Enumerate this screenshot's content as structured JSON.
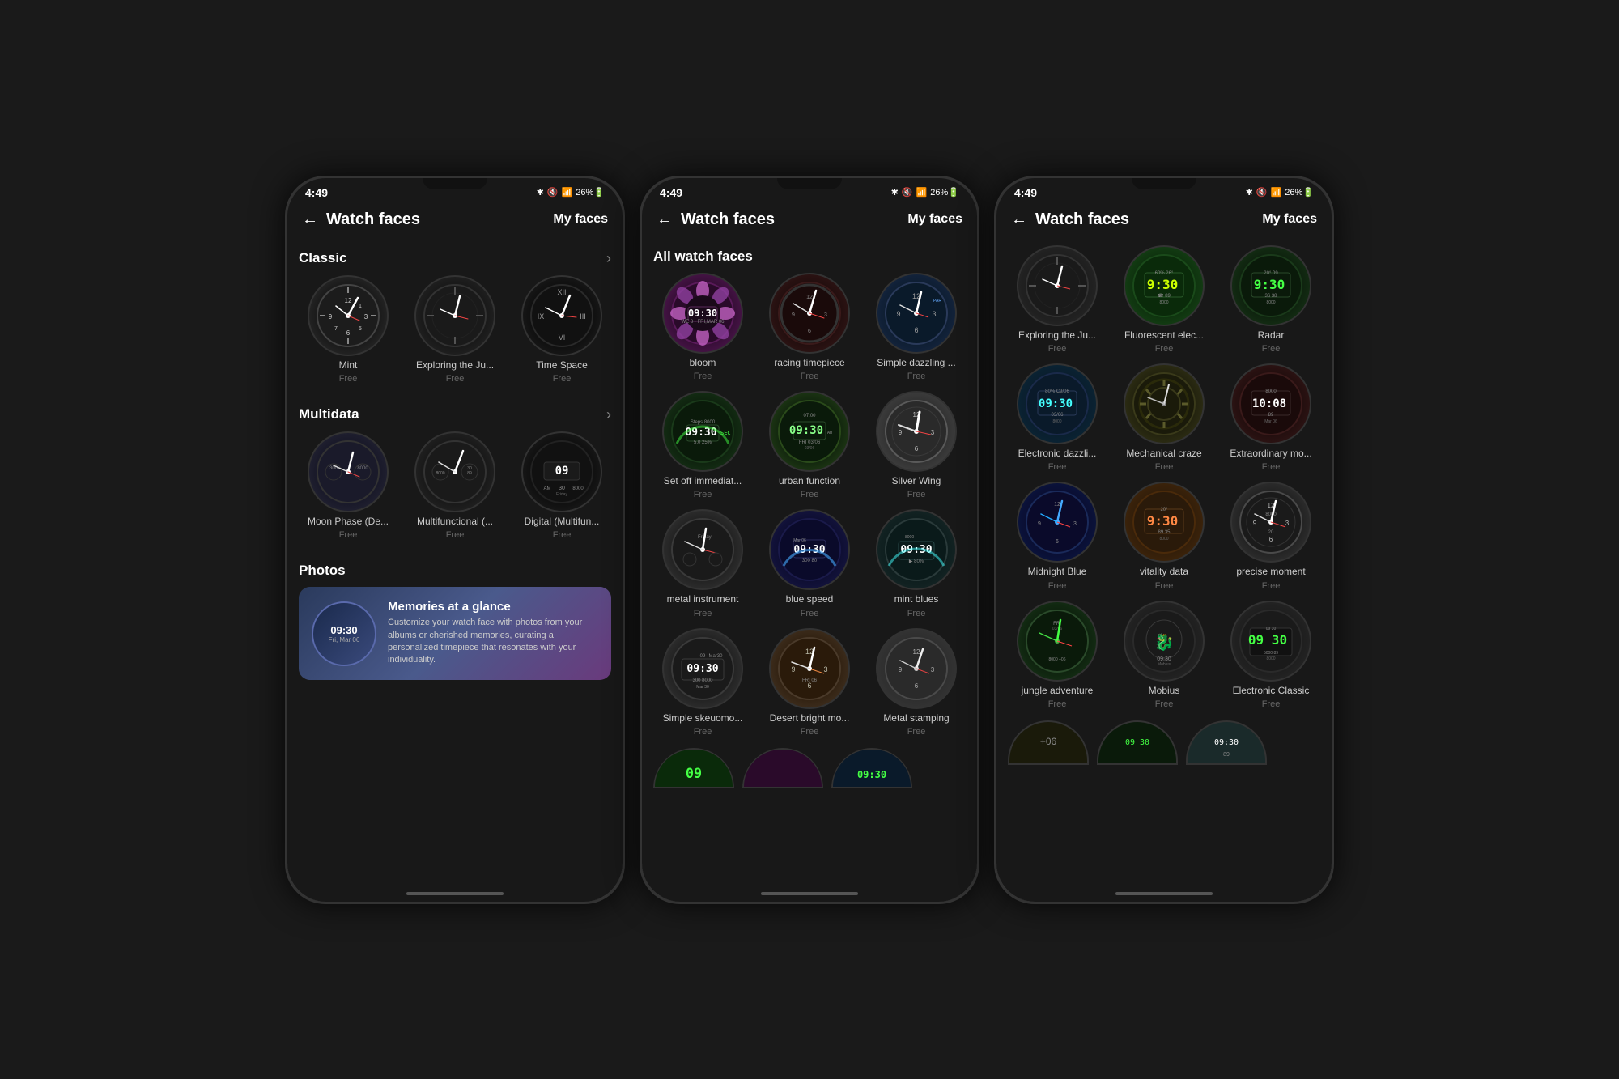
{
  "phones": [
    {
      "id": "phone1",
      "statusBar": {
        "time": "4:49",
        "icons": "✱ 🔇 ☁ ▲ 26%🔋"
      },
      "header": {
        "back": "←",
        "title": "Watch faces",
        "myFaces": "My faces"
      },
      "sections": [
        {
          "id": "classic",
          "title": "Classic",
          "hasArrow": true,
          "items": [
            {
              "label": "Mint",
              "sublabel": "Free",
              "wfClass": "wf-classic-mint",
              "type": "analog-simple"
            },
            {
              "label": "Exploring the Ju...",
              "sublabel": "Free",
              "wfClass": "wf-classic-exploring",
              "type": "analog-dark"
            },
            {
              "label": "Time Space",
              "sublabel": "Free",
              "wfClass": "wf-classic-timespace",
              "type": "analog-minimal"
            }
          ]
        },
        {
          "id": "multidata",
          "title": "Multidata",
          "hasArrow": true,
          "items": [
            {
              "label": "Moon Phase (De...",
              "sublabel": "Free",
              "wfClass": "wf-moon",
              "type": "analog-moon"
            },
            {
              "label": "Multifunctional (...",
              "sublabel": "Free",
              "wfClass": "wf-multifunc",
              "type": "analog-multi"
            },
            {
              "label": "Digital (Multifun...",
              "sublabel": "Free",
              "wfClass": "wf-digital",
              "type": "digital-multi"
            }
          ]
        }
      ],
      "photosSection": {
        "title": "Photos",
        "bannerTitle": "Memories at a glance",
        "bannerText": "Customize your watch face with photos from your albums or cherished memories, curating a personalized timepiece that resonates with your individuality.",
        "watchTime": "09:30",
        "watchDate": "Fri, Mar 06"
      }
    },
    {
      "id": "phone2",
      "statusBar": {
        "time": "4:49",
        "icons": "✱ 🔇 ☁ ▲ 26%🔋"
      },
      "header": {
        "back": "←",
        "title": "Watch faces",
        "myFaces": "My faces"
      },
      "sectionTitle": "All watch faces",
      "items": [
        {
          "label": "bloom",
          "sublabel": "Free",
          "wfClass": "wf-bloom",
          "type": "bloom"
        },
        {
          "label": "racing timepiece",
          "sublabel": "Free",
          "wfClass": "wf-racing",
          "type": "racing"
        },
        {
          "label": "Simple dazzling ...",
          "sublabel": "Free",
          "wfClass": "wf-simple-dazzle",
          "type": "simple-dazzle"
        },
        {
          "label": "Set off immediat...",
          "sublabel": "Free",
          "wfClass": "wf-setoff",
          "type": "setoff"
        },
        {
          "label": "urban function",
          "sublabel": "Free",
          "wfClass": "wf-urban",
          "type": "urban"
        },
        {
          "label": "Silver Wing",
          "sublabel": "Free",
          "wfClass": "wf-silver",
          "type": "silver"
        },
        {
          "label": "metal instrument",
          "sublabel": "Free",
          "wfClass": "wf-metal",
          "type": "metal"
        },
        {
          "label": "blue speed",
          "sublabel": "Free",
          "wfClass": "wf-blue-speed",
          "type": "blue-speed"
        },
        {
          "label": "mint blues",
          "sublabel": "Free",
          "wfClass": "wf-mint-blues",
          "type": "mint-blues"
        },
        {
          "label": "Simple skeuomo...",
          "sublabel": "Free",
          "wfClass": "wf-simple-skeu",
          "type": "simple-skeu"
        },
        {
          "label": "Desert bright mo...",
          "sublabel": "Free",
          "wfClass": "wf-desert",
          "type": "desert"
        },
        {
          "label": "Metal stamping",
          "sublabel": "Free",
          "wfClass": "wf-metal-stamp",
          "type": "metal-stamp"
        }
      ]
    },
    {
      "id": "phone3",
      "statusBar": {
        "time": "4:49",
        "icons": "✱ 🔇 ☁ ▲ 26%🔋"
      },
      "header": {
        "back": "←",
        "title": "Watch faces",
        "myFaces": "My faces"
      },
      "items": [
        {
          "label": "Exploring the Ju...",
          "sublabel": "Free",
          "wfClass": "wf-exploring-ju",
          "type": "analog-dark"
        },
        {
          "label": "Fluorescent elec...",
          "sublabel": "Free",
          "wfClass": "wf-fluorescent",
          "type": "fluorescent"
        },
        {
          "label": "Radar",
          "sublabel": "Free",
          "wfClass": "wf-radar",
          "type": "radar"
        },
        {
          "label": "Electronic dazzli...",
          "sublabel": "Free",
          "wfClass": "wf-elec-dazzle",
          "type": "elec-dazzle"
        },
        {
          "label": "Mechanical craze",
          "sublabel": "Free",
          "wfClass": "wf-mech-craze",
          "type": "mech-craze"
        },
        {
          "label": "Extraordinary mo...",
          "sublabel": "Free",
          "wfClass": "wf-extraordinary",
          "type": "extraordinary"
        },
        {
          "label": "Midnight Blue",
          "sublabel": "Free",
          "wfClass": "wf-midnight",
          "type": "midnight"
        },
        {
          "label": "vitality data",
          "sublabel": "Free",
          "wfClass": "wf-vitality",
          "type": "vitality"
        },
        {
          "label": "precise moment",
          "sublabel": "Free",
          "wfClass": "wf-precise",
          "type": "precise"
        },
        {
          "label": "jungle adventure",
          "sublabel": "Free",
          "wfClass": "wf-jungle",
          "type": "jungle"
        },
        {
          "label": "Mobius",
          "sublabel": "Free",
          "wfClass": "wf-mobius",
          "type": "mobius"
        },
        {
          "label": "Electronic Classic",
          "sublabel": "Free",
          "wfClass": "wf-elec-classic",
          "type": "elec-classic"
        }
      ]
    }
  ]
}
